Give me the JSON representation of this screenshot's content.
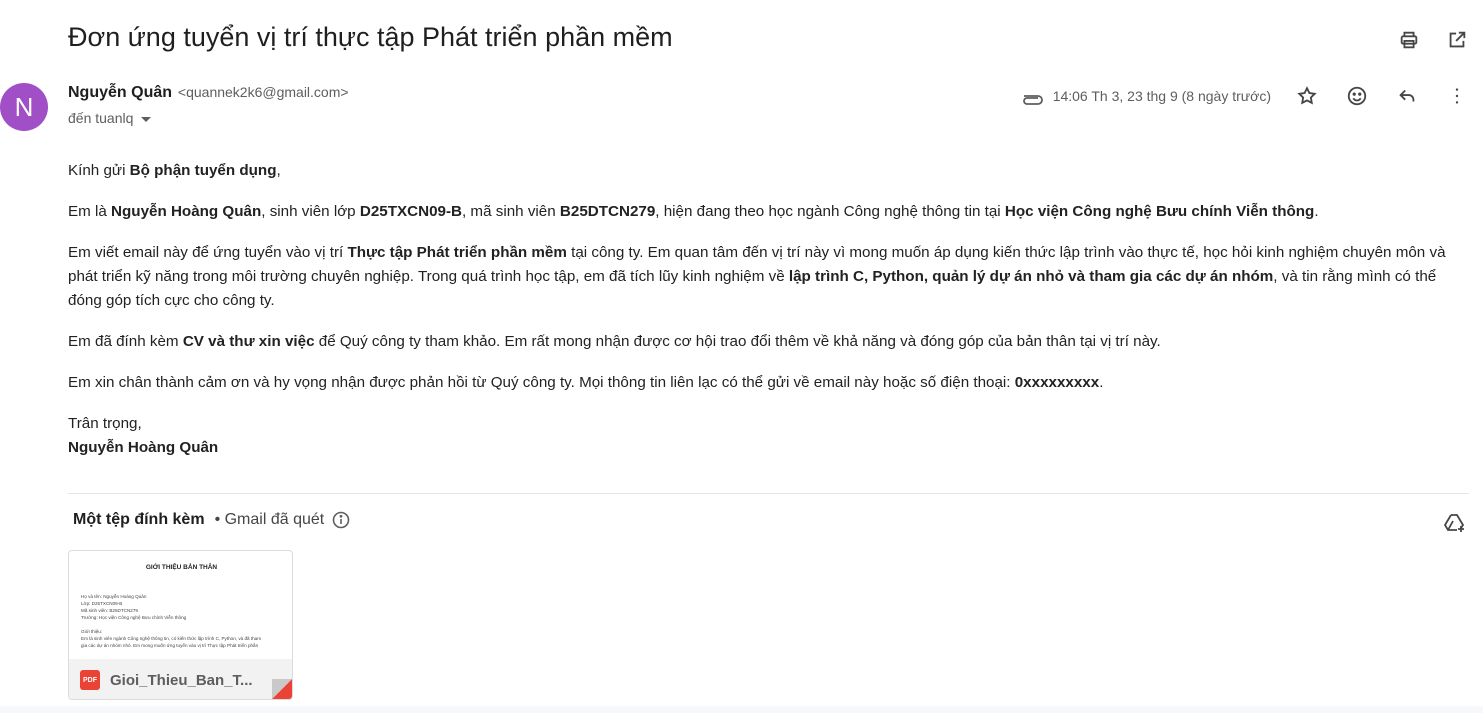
{
  "subject": "Đơn ứng tuyển vị trí thực tập Phát triển phần mềm",
  "sender": {
    "avatar_letter": "N",
    "avatar_color": "#a04fc6",
    "name": "Nguyễn Quân",
    "email": "<quannek2k6@gmail.com>",
    "recipient": "đến tuanlq"
  },
  "meta": {
    "date": "14:06 Th 3, 23 thg 9 (8 ngày trước)"
  },
  "icons": {
    "print": "print-icon",
    "open_new": "open-in-new-window-icon",
    "attachment": "paperclip-icon",
    "star": "star-icon",
    "emoji": "emoji-reaction-icon",
    "reply": "reply-icon",
    "more": "more-vertical-icon",
    "info": "info-icon",
    "drive": "add-to-drive-icon"
  },
  "body": {
    "greeting_pre": "Kính gửi ",
    "greeting_bold": "Bộ phận tuyển dụng",
    "greeting_post": ",",
    "p1_a": "Em là ",
    "p1_b": "Nguyễn Hoàng Quân",
    "p1_c": ", sinh viên lớp ",
    "p1_d": "D25TXCN09-B",
    "p1_e": ", mã sinh viên ",
    "p1_f": "B25DTCN279",
    "p1_g": ", hiện đang theo học ngành Công nghệ thông tin tại ",
    "p1_h": "Học viện Công nghệ Bưu chính Viễn thông",
    "p1_i": ".",
    "p2_a": "Em viết email này để ứng tuyển vào vị trí ",
    "p2_b": "Thực tập Phát triển phần mềm",
    "p2_c": " tại công ty. Em quan tâm đến vị trí này vì mong muốn áp dụng kiến thức lập trình vào thực tế, học hỏi kinh nghiệm chuyên môn và phát triển kỹ năng trong môi trường chuyên nghiệp. Trong quá trình học tập, em đã tích lũy kinh nghiệm về ",
    "p2_d": "lập trình C, Python, quản lý dự án nhỏ và tham gia các dự án nhóm",
    "p2_e": ", và tin rằng mình có thể đóng góp tích cực cho công ty.",
    "p3_a": "Em đã đính kèm ",
    "p3_b": "CV và thư xin việc",
    "p3_c": " để Quý công ty tham khảo. Em rất mong nhận được cơ hội trao đổi thêm về khả năng và đóng góp của bản thân tại vị trí này.",
    "p4_a": "Em xin chân thành cảm ơn và hy vọng nhận được phản hồi từ Quý công ty. Mọi thông tin liên lạc có thể gửi về email này hoặc số điện thoại: ",
    "p4_b": "0xxxxxxxxx",
    "p4_c": ".",
    "closing": "Trân trọng,",
    "signature": "Nguyễn Hoàng Quân"
  },
  "attachments": {
    "title": "Một tệp đính kèm",
    "scan_note": " • Gmail đã quét",
    "file": {
      "type_badge": "PDF",
      "name": "Gioi_Thieu_Ban_T...",
      "preview_title": "GIỚI THIỆU BẢN THÂN",
      "preview_lines_1": [
        "Họ và tên: Nguyễn Hoàng Quân",
        "Lớp: D25TXCN09-B",
        "Mã sinh viên: B25DTCN279",
        "Trường: Học viện Công nghệ Bưu chính Viễn thông"
      ],
      "preview_lines_2": [
        "Giới thiệu:",
        "Em là sinh viên ngành Công nghệ thông tin, có kiến thức lập trình C, Python, và đã tham",
        "gia các dự án nhóm nhỏ. Em mong muốn ứng tuyển vào vị trí Thực tập Phát triển phần"
      ]
    }
  }
}
